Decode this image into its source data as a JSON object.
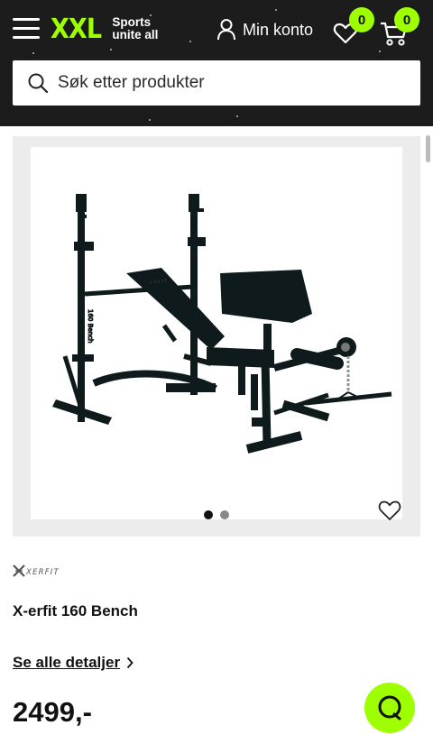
{
  "header": {
    "logo": {
      "mark": "XXL",
      "tagline_line1": "Sports",
      "tagline_line2": "unite all"
    },
    "account_label": "Min konto",
    "wishlist_count": "0",
    "cart_count": "0",
    "search": {
      "placeholder": "Søk etter produkter"
    },
    "accent_color": "#9dff00",
    "background_color": "#1c1c1c"
  },
  "gallery": {
    "image": "weight-bench-with-rack",
    "image_count": 2,
    "active_index": 0
  },
  "product": {
    "brand": "XERFIT",
    "name": "X-erfit 160 Bench",
    "details_link": "Se alle detaljer",
    "price": "2499,-"
  },
  "icons": [
    "menu-icon",
    "user-icon",
    "heart-icon",
    "cart-icon",
    "search-icon",
    "chevron-right-icon",
    "chat-icon"
  ]
}
